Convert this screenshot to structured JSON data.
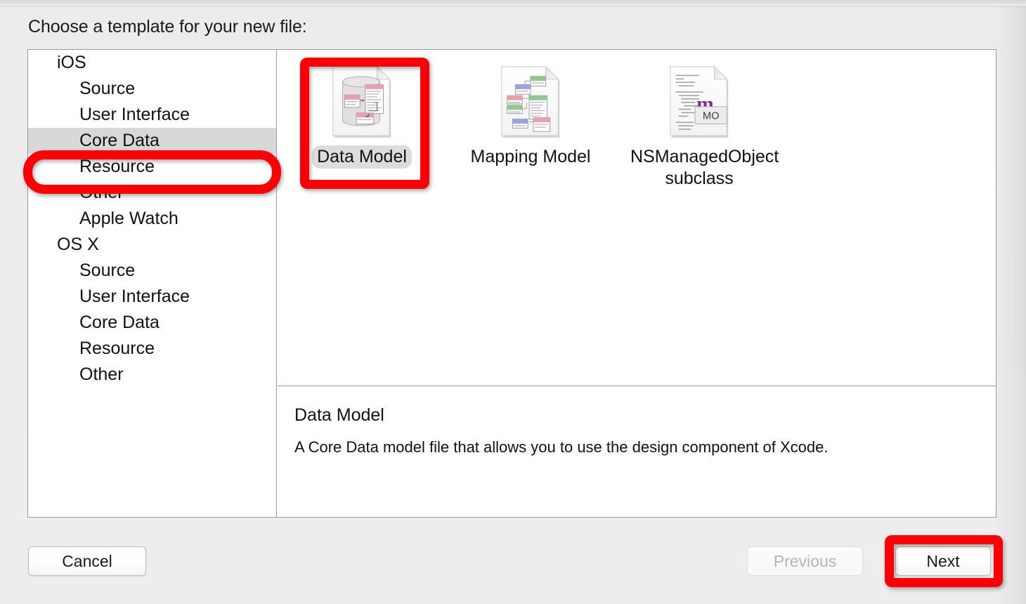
{
  "dialog": {
    "prompt": "Choose a template for your new file:"
  },
  "categories": [
    {
      "label": "iOS",
      "type": "group",
      "selected": false
    },
    {
      "label": "Source",
      "type": "item",
      "selected": false
    },
    {
      "label": "User Interface",
      "type": "item",
      "selected": false
    },
    {
      "label": "Core Data",
      "type": "item",
      "selected": true
    },
    {
      "label": "Resource",
      "type": "item",
      "selected": false
    },
    {
      "label": "Other",
      "type": "item",
      "selected": false
    },
    {
      "label": "Apple Watch",
      "type": "item",
      "selected": false
    },
    {
      "label": "OS X",
      "type": "group",
      "selected": false
    },
    {
      "label": "Source",
      "type": "item",
      "selected": false
    },
    {
      "label": "User Interface",
      "type": "item",
      "selected": false
    },
    {
      "label": "Core Data",
      "type": "item",
      "selected": false
    },
    {
      "label": "Resource",
      "type": "item",
      "selected": false
    },
    {
      "label": "Other",
      "type": "item",
      "selected": false
    }
  ],
  "templates": [
    {
      "label": "Data Model",
      "icon": "data-model-document-icon",
      "selected": true
    },
    {
      "label": "Mapping Model",
      "icon": "mapping-model-document-icon",
      "selected": false
    },
    {
      "label": "NSManagedObject subclass",
      "icon": "nsmanagedobject-source-icon",
      "selected": false
    }
  ],
  "description": {
    "title": "Data Model",
    "body": "A Core Data model file that allows you to use the design component of Xcode."
  },
  "buttons": {
    "cancel": "Cancel",
    "previous": "Previous",
    "next": "Next"
  },
  "annotations": {
    "color": "#fb0007",
    "targets": [
      "Core Data",
      "Data Model",
      "Next"
    ]
  },
  "icon_glyphs": {
    "managed_object_letter": "m",
    "managed_object_badge": "MO"
  },
  "colors": {
    "dialog_background": "#ececec",
    "panel_background": "#ffffff",
    "panel_border": "#9a9a9a",
    "selection_fill": "#d8d8d8",
    "annotation_red": "#fb0007",
    "disabled_text": "#b4b4b4",
    "entity_pink": "#e8a0ae",
    "entity_green": "#8fc98f",
    "entity_blue": "#9aa4d8",
    "managed_object_purple": "#7b2d8e"
  }
}
